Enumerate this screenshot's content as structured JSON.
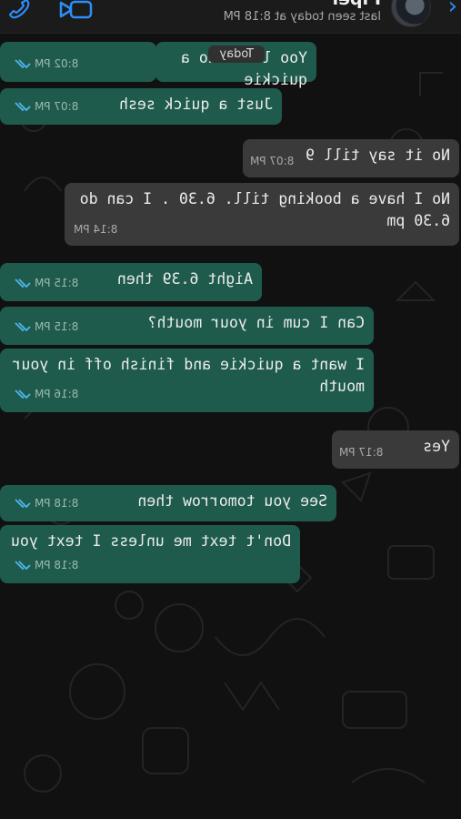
{
  "header": {
    "back_label": "‹",
    "contact_name": "Piper",
    "last_seen": "last seen today at 8:18 PM",
    "video_icon": "video-camera-icon",
    "call_icon": "phone-icon"
  },
  "date_divider": "Today",
  "colors": {
    "outgoing_bubble": "#1e5b4d",
    "incoming_bubble": "#3a3a3a",
    "tick_blue": "#4fb6ec",
    "accent": "#2c8ef8"
  },
  "messages": [
    {
      "direction": "out",
      "text": "Yoo let's do a quickie",
      "time": "8:02 PM",
      "status": "read"
    },
    {
      "direction": "out",
      "text": "Just a quick sesh",
      "time": "8:07 PM",
      "status": "read"
    },
    {
      "direction": "in",
      "text": "No it say till 9",
      "time": "8:07 PM"
    },
    {
      "direction": "in",
      "text": "No I have a booking till. 6.30 . I can do 6.30 pm",
      "time": "8:14 PM"
    },
    {
      "direction": "out",
      "text": "Aight 6.39 then",
      "time": "8:15 PM",
      "status": "read"
    },
    {
      "direction": "out",
      "text": "Can I cum in your mouth?",
      "time": "8:15 PM",
      "status": "read"
    },
    {
      "direction": "out",
      "text": "I want a quickie and finish off in your mouth",
      "time": "8:16 PM",
      "status": "read"
    },
    {
      "direction": "in",
      "text": "Yes",
      "time": "8:17 PM"
    },
    {
      "direction": "out",
      "text": "See you tomorrow then",
      "time": "8:18 PM",
      "status": "read"
    },
    {
      "direction": "out",
      "text": "Don't text me unless I text you",
      "time": "8:18 PM",
      "status": "read"
    }
  ]
}
